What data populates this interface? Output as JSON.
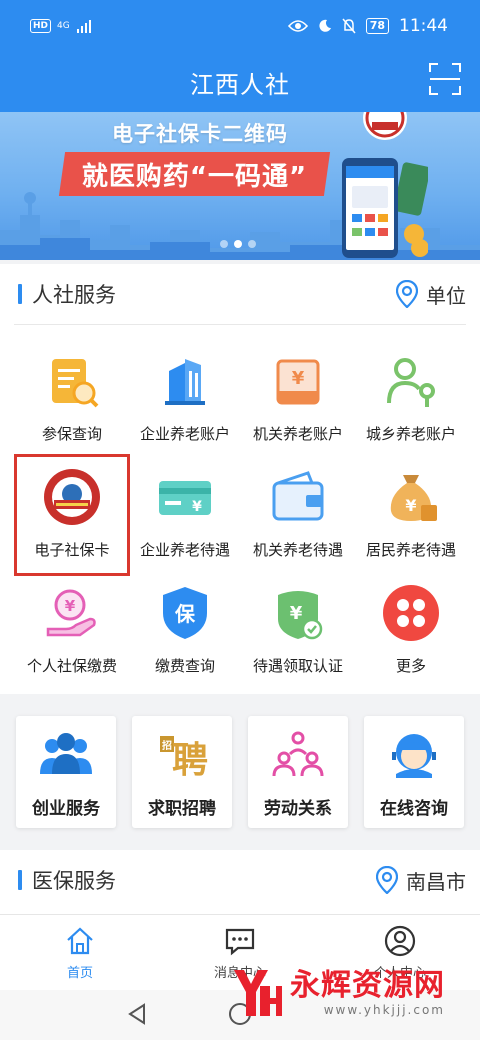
{
  "status_bar": {
    "hd": "HD",
    "network": "4G",
    "battery": "78",
    "time": "11:44"
  },
  "header": {
    "title": "江西人社",
    "scan_icon": "scan-icon"
  },
  "banner": {
    "line1": "电子社保卡二维码",
    "line2": "就医购药“一码通”",
    "active_dot": 1
  },
  "hr_services": {
    "title": "人社服务",
    "location_label": "单位",
    "items": [
      {
        "label": "参保查询",
        "icon": "insurance-query-icon"
      },
      {
        "label": "企业养老账户",
        "icon": "enterprise-building-icon"
      },
      {
        "label": "机关养老账户",
        "icon": "yuan-box-icon"
      },
      {
        "label": "城乡养老账户",
        "icon": "person-key-icon"
      },
      {
        "label": "电子社保卡",
        "icon": "social-security-card-icon"
      },
      {
        "label": "企业养老待遇",
        "icon": "yuan-card-icon"
      },
      {
        "label": "机关养老待遇",
        "icon": "wallet-icon"
      },
      {
        "label": "居民养老待遇",
        "icon": "money-bag-icon"
      },
      {
        "label": "个人社保缴费",
        "icon": "hand-yuan-icon"
      },
      {
        "label": "缴费查询",
        "icon": "shield-bao-icon"
      },
      {
        "label": "待遇领取认证",
        "icon": "verified-yuan-icon"
      },
      {
        "label": "更多",
        "icon": "more-icon"
      }
    ],
    "highlighted_item": "电子社保卡"
  },
  "quick_tiles": [
    {
      "label": "创业服务",
      "icon": "team-icon"
    },
    {
      "label": "求职招聘",
      "icon": "recruit-icon"
    },
    {
      "label": "劳动关系",
      "icon": "relation-icon"
    },
    {
      "label": "在线咨询",
      "icon": "customer-service-icon"
    }
  ],
  "medical_services": {
    "title": "医保服务",
    "location_label": "南昌市"
  },
  "tabbar": [
    {
      "label": "首页",
      "icon": "home-icon",
      "active": true
    },
    {
      "label": "消息中心",
      "icon": "message-icon",
      "active": false
    },
    {
      "label": "个人中心",
      "icon": "user-icon",
      "active": false
    }
  ],
  "watermark": {
    "text": "永辉资源网",
    "url": "www.yhkjjj.com"
  },
  "colors": {
    "primary": "#2d8cf0",
    "highlight_border": "#d9382e",
    "banner_red": "#e9524a"
  }
}
